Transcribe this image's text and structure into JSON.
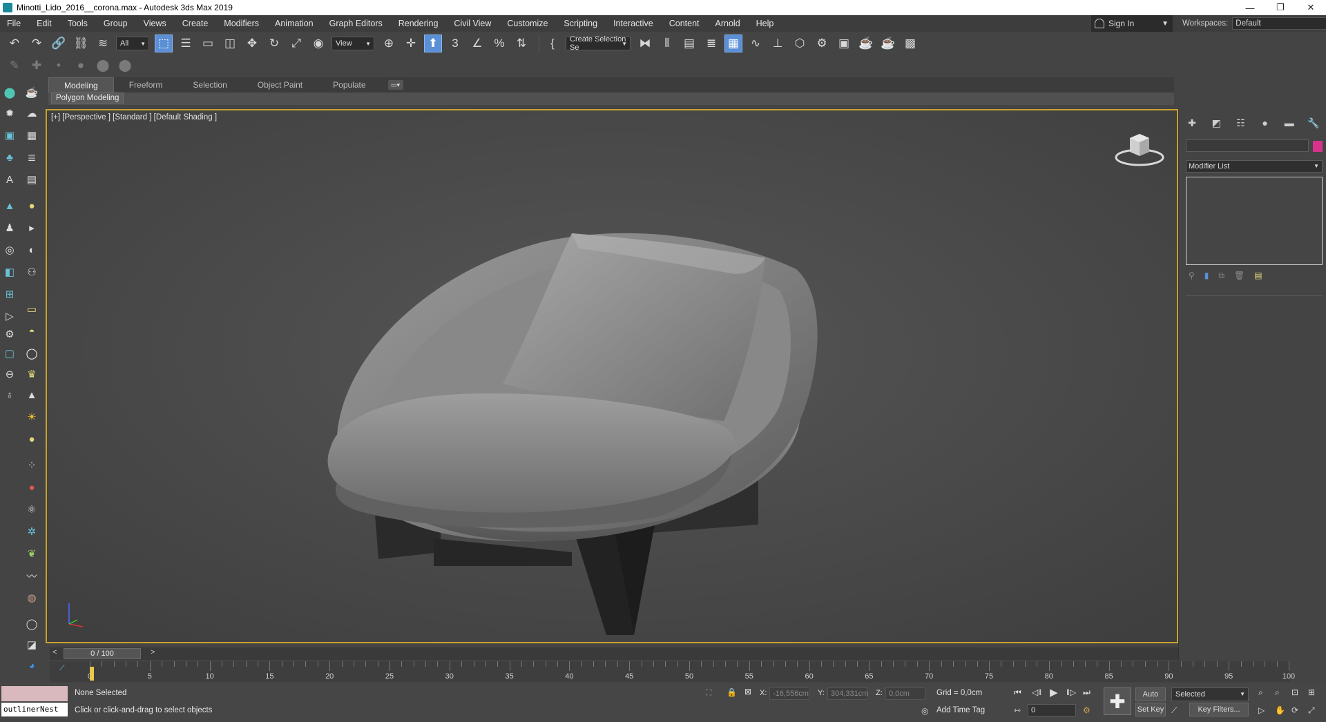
{
  "window": {
    "title": "Minotti_Lido_2016__corona.max - Autodesk 3ds Max 2019",
    "minimize": "—",
    "restore": "❐",
    "close": "✕"
  },
  "menu": [
    "File",
    "Edit",
    "Tools",
    "Group",
    "Views",
    "Create",
    "Modifiers",
    "Animation",
    "Graph Editors",
    "Rendering",
    "Civil View",
    "Customize",
    "Scripting",
    "Interactive",
    "Content",
    "Arnold",
    "Help"
  ],
  "signin": {
    "label": "Sign In"
  },
  "workspaces": {
    "label": "Workspaces:",
    "value": "Default"
  },
  "toolbar": {
    "selection_filter": "All",
    "ref_coord": "View",
    "named_selection": "Create Selection Se"
  },
  "ribbon": {
    "tabs": [
      "Modeling",
      "Freeform",
      "Selection",
      "Object Paint",
      "Populate"
    ],
    "active_tab": "Modeling",
    "sub_label": "Polygon Modeling"
  },
  "viewport": {
    "label": "[+] [Perspective ] [Standard ] [Default Shading ]"
  },
  "command_panel": {
    "modifier_list": "Modifier List",
    "object_color": "#d8338c"
  },
  "timeline": {
    "frame_display": "0 / 100",
    "prev": "<",
    "next": ">",
    "ticks": [
      0,
      5,
      10,
      15,
      20,
      25,
      30,
      35,
      40,
      45,
      50,
      55,
      60,
      65,
      70,
      75,
      80,
      85,
      90,
      95,
      100
    ],
    "current_frame": 0
  },
  "status": {
    "selection": "None Selected",
    "hint": "Click or click-and-drag to select objects",
    "maxscript": "outlinerNest",
    "x_label": "X:",
    "x_value": "-16,556cm",
    "y_label": "Y:",
    "y_value": "304,331cm",
    "z_label": "Z:",
    "z_value": "0,0cm",
    "grid": "Grid = 0,0cm",
    "add_time_tag": "Add Time Tag",
    "auto_key": "Auto Key",
    "set_key": "Set Key",
    "selected_set": "Selected",
    "key_filters": "Key Filters...",
    "frame": "0"
  },
  "colors": {
    "viewport_border": "#c9a22b",
    "active_tool": "#5b8fd6",
    "viewport_bg": "#4a4a4a"
  }
}
